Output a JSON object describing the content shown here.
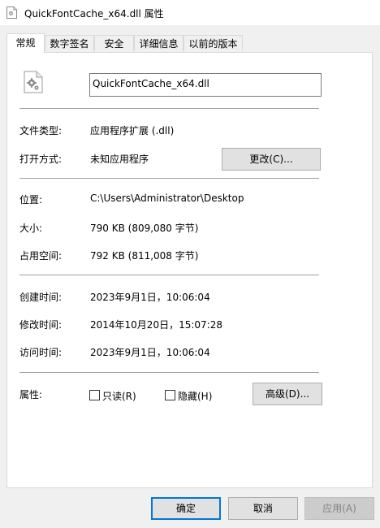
{
  "window": {
    "title": "QuickFontCache_x64.dll 属性"
  },
  "tabs": [
    {
      "label": "常规"
    },
    {
      "label": "数字签名"
    },
    {
      "label": "安全"
    },
    {
      "label": "详细信息"
    },
    {
      "label": "以前的版本"
    }
  ],
  "general": {
    "file_name": "QuickFontCache_x64.dll",
    "file_type_label": "文件类型:",
    "file_type_value": "应用程序扩展 (.dll)",
    "open_with_label": "打开方式:",
    "open_with_value": "未知应用程序",
    "change_button": "更改(C)...",
    "location_label": "位置:",
    "location_value": "C:\\Users\\Administrator\\Desktop",
    "size_label": "大小:",
    "size_value": "790 KB (809,080 字节)",
    "size_on_disk_label": "占用空间:",
    "size_on_disk_value": "792 KB (811,008 字节)",
    "created_label": "创建时间:",
    "created_value": "2023年9月1日，10:06:04",
    "modified_label": "修改时间:",
    "modified_value": "2014年10月20日，15:07:28",
    "accessed_label": "访问时间:",
    "accessed_value": "2023年9月1日，10:06:04",
    "attributes_label": "属性:",
    "readonly_label": "只读(R)",
    "readonly_checked": false,
    "hidden_label": "隐藏(H)",
    "hidden_checked": false,
    "advanced_button": "高级(D)..."
  },
  "footer": {
    "ok": "确定",
    "cancel": "取消",
    "apply": "应用(A)"
  }
}
